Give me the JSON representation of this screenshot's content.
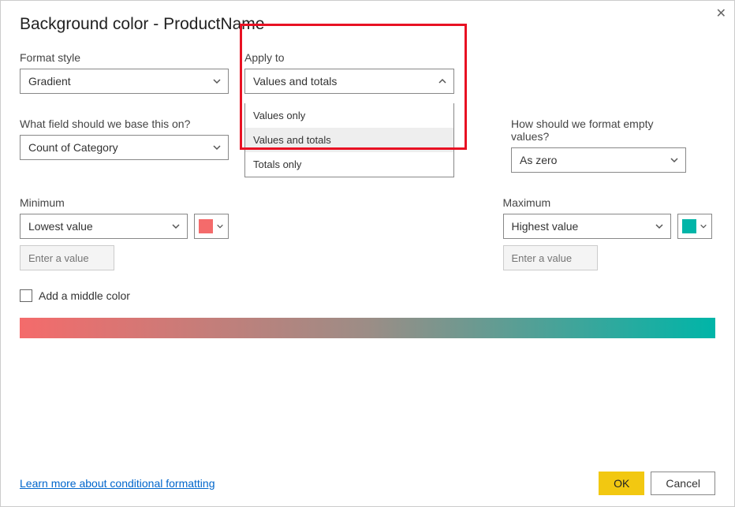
{
  "title": "Background color - ProductName",
  "labels": {
    "formatStyle": "Format style",
    "applyTo": "Apply to",
    "baseField": "What field should we base this on?",
    "emptyValues": "How should we format empty values?",
    "minimum": "Minimum",
    "maximum": "Maximum",
    "addMiddle": "Add a middle color"
  },
  "values": {
    "formatStyle": "Gradient",
    "applyTo": "Values and totals",
    "baseField": "Count of Category",
    "emptyValues": "As zero",
    "minimum": "Lowest value",
    "maximum": "Highest value"
  },
  "placeholders": {
    "enterValue": "Enter a value"
  },
  "applyToOptions": [
    "Values only",
    "Values and totals",
    "Totals only"
  ],
  "colors": {
    "min": "#f46b6b",
    "max": "#00b5a8"
  },
  "footer": {
    "link": "Learn more about conditional formatting",
    "ok": "OK",
    "cancel": "Cancel"
  }
}
